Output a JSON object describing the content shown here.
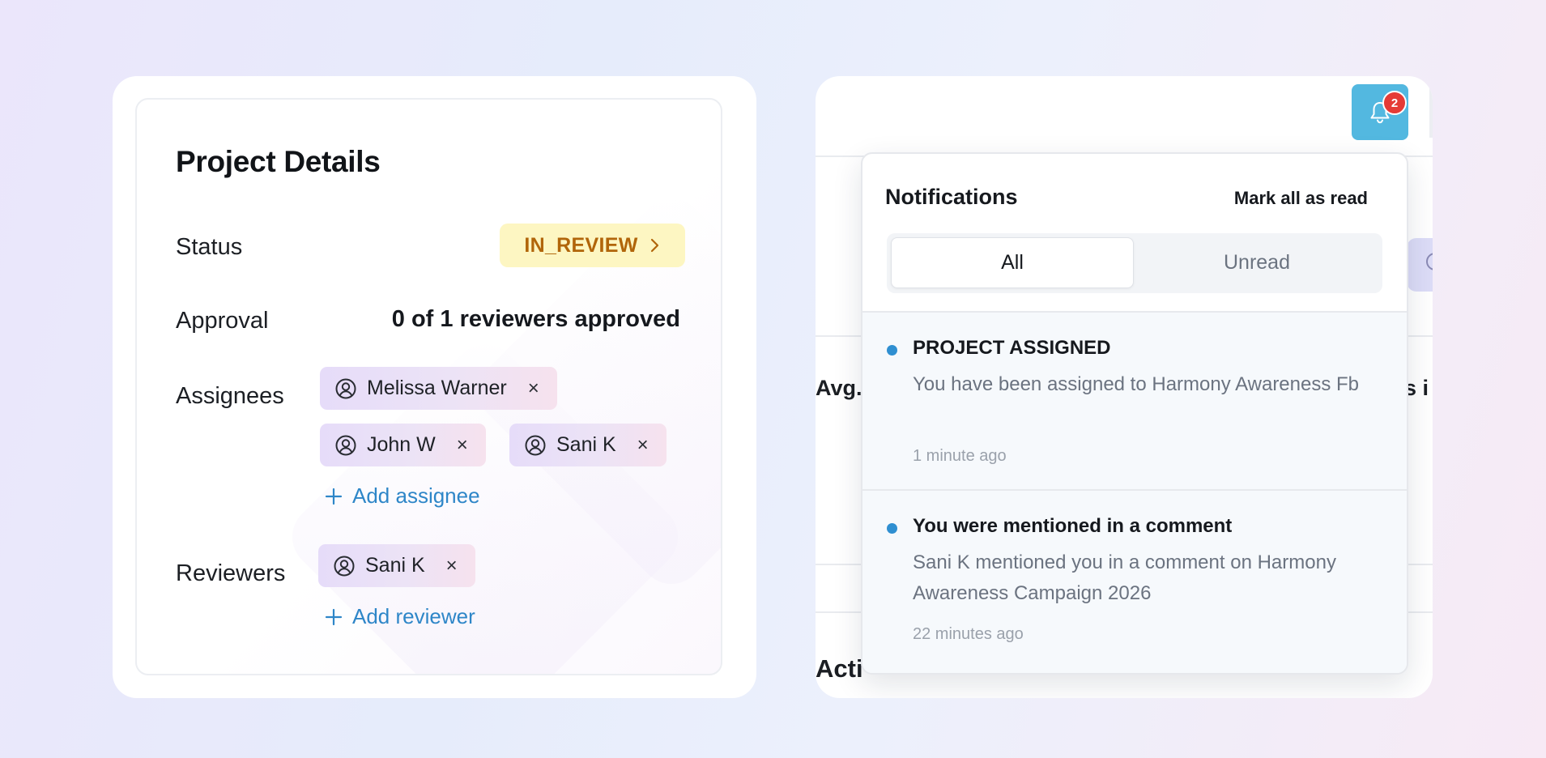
{
  "project_details": {
    "title": "Project Details",
    "status": {
      "label": "Status",
      "value": "IN_REVIEW",
      "color": "#b1650a",
      "background": "#fdf6c2"
    },
    "approval": {
      "label": "Approval",
      "value": "0 of 1 reviewers approved"
    },
    "assignees": {
      "label": "Assignees",
      "people": [
        {
          "name": "Melissa Warner",
          "remove": "×"
        },
        {
          "name": "John W",
          "remove": "×"
        },
        {
          "name": "Sani K",
          "remove": "×"
        }
      ],
      "add_label": "Add assignee"
    },
    "reviewers": {
      "label": "Reviewers",
      "people": [
        {
          "name": "Sani K",
          "remove": "×"
        }
      ],
      "add_label": "Add reviewer"
    }
  },
  "header": {
    "bell": {
      "icon": "bell-icon",
      "badge_count": "2",
      "color": "#53b8e0",
      "badge_color": "#e53b36"
    }
  },
  "background_text": {
    "left_fragment": "Avg.",
    "right_fragment": "s i",
    "bottom_fragment": "Acti"
  },
  "notifications": {
    "title": "Notifications",
    "mark_all": "Mark all as read",
    "tabs": [
      {
        "label": "All",
        "active": true
      },
      {
        "label": "Unread",
        "active": false
      }
    ],
    "items": [
      {
        "title": "PROJECT ASSIGNED",
        "body": "You have been assigned to Harmony Awareness Fb",
        "time": "1 minute ago",
        "unread": true
      },
      {
        "title": "You were mentioned in a comment",
        "body": "Sani K mentioned you in a comment on Harmony Awareness Campaign 2026",
        "time": "22 minutes ago",
        "unread": true
      }
    ],
    "dot_color": "#2f8fd1"
  },
  "accent": {
    "link": "#2e86c8"
  }
}
